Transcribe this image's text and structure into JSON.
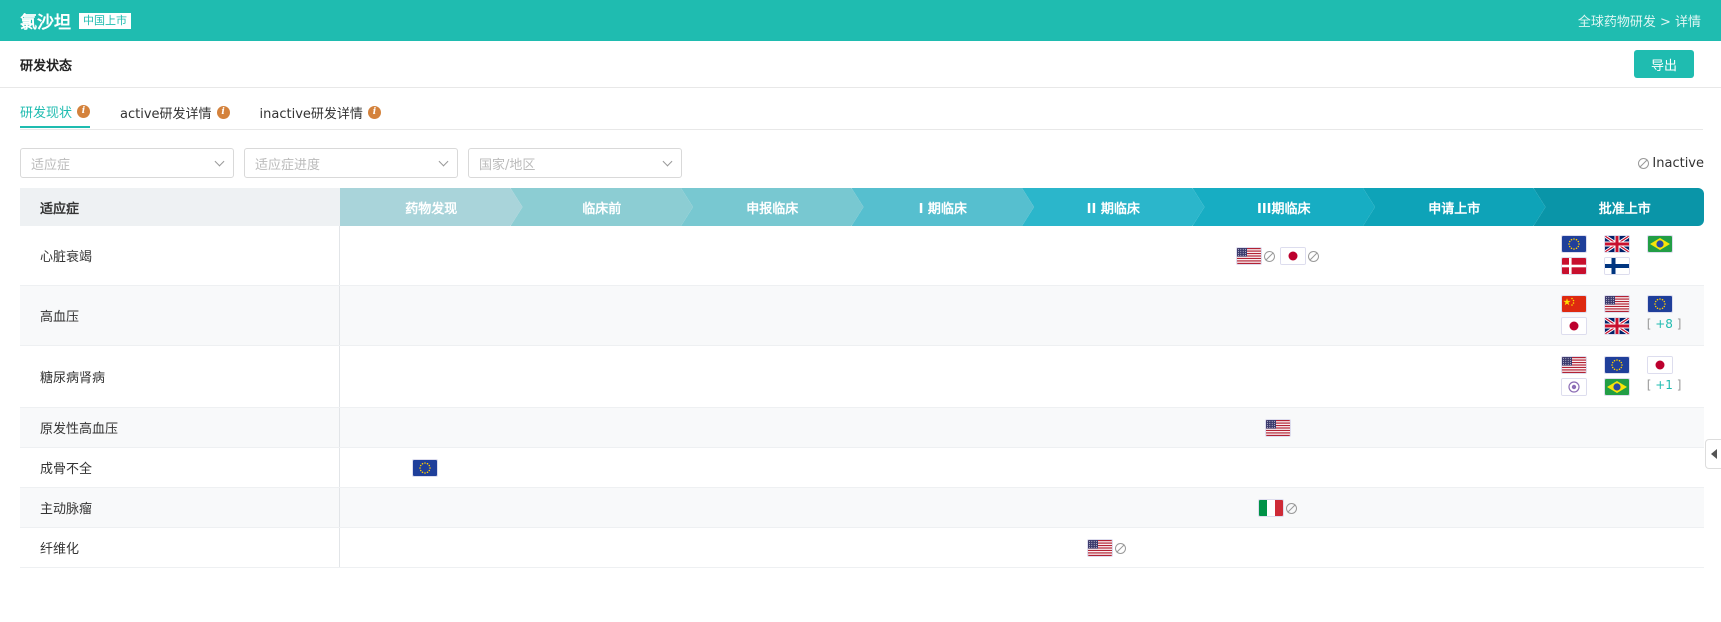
{
  "header": {
    "title": "氯沙坦",
    "tag": "中国上市",
    "breadcrumb": "全球药物研发 > 详情"
  },
  "section": {
    "title": "研发状态",
    "export_label": "导出"
  },
  "tabs": [
    {
      "label": "研发现状",
      "active": true
    },
    {
      "label": "active研发详情",
      "active": false
    },
    {
      "label": "inactive研发详情",
      "active": false
    }
  ],
  "filters": [
    {
      "placeholder": "适应症"
    },
    {
      "placeholder": "适应症进度"
    },
    {
      "placeholder": "国家/地区"
    }
  ],
  "legend": {
    "label": "Inactive"
  },
  "table": {
    "indication_header": "适应症",
    "phases": [
      {
        "label": "药物发现",
        "color": "#a9d4da"
      },
      {
        "label": "临床前",
        "color": "#8ccdd3"
      },
      {
        "label": "申报临床",
        "color": "#78c8d1"
      },
      {
        "label": "I 期临床",
        "color": "#56bfcf"
      },
      {
        "label": "II 期临床",
        "color": "#2bb6cb"
      },
      {
        "label": "III期临床",
        "color": "#17adc3"
      },
      {
        "label": "申请上市",
        "color": "#0ea3b8"
      },
      {
        "label": "批准上市",
        "color": "#0a95a8"
      }
    ],
    "rows": [
      {
        "indication": "心脏衰竭",
        "flags": [
          {
            "phase": 5,
            "country": "us",
            "inactive": true
          },
          {
            "phase": 5,
            "country": "jp",
            "inactive": true
          },
          {
            "phase": 7,
            "country": "eu"
          },
          {
            "phase": 7,
            "country": "gb"
          },
          {
            "phase": 7,
            "country": "br"
          },
          {
            "phase": 7,
            "country": "dk"
          },
          {
            "phase": 7,
            "country": "fi"
          }
        ]
      },
      {
        "indication": "高血压",
        "more": "+8",
        "flags": [
          {
            "phase": 7,
            "country": "cn"
          },
          {
            "phase": 7,
            "country": "us"
          },
          {
            "phase": 7,
            "country": "eu"
          },
          {
            "phase": 7,
            "country": "jp"
          },
          {
            "phase": 7,
            "country": "gb"
          }
        ]
      },
      {
        "indication": "糖尿病肾病",
        "more": "+1",
        "flags": [
          {
            "phase": 7,
            "country": "us"
          },
          {
            "phase": 7,
            "country": "eu"
          },
          {
            "phase": 7,
            "country": "jp"
          },
          {
            "phase": 7,
            "country": "tw"
          },
          {
            "phase": 7,
            "country": "br"
          }
        ]
      },
      {
        "indication": "原发性高血压",
        "flags": [
          {
            "phase": 5,
            "country": "us"
          }
        ]
      },
      {
        "indication": "成骨不全",
        "flags": [
          {
            "phase": 0,
            "country": "eu"
          }
        ]
      },
      {
        "indication": "主动脉瘤",
        "flags": [
          {
            "phase": 5,
            "country": "it",
            "inactive": true
          }
        ]
      },
      {
        "indication": "纤维化",
        "flags": [
          {
            "phase": 4,
            "country": "us",
            "inactive": true
          }
        ]
      }
    ]
  }
}
